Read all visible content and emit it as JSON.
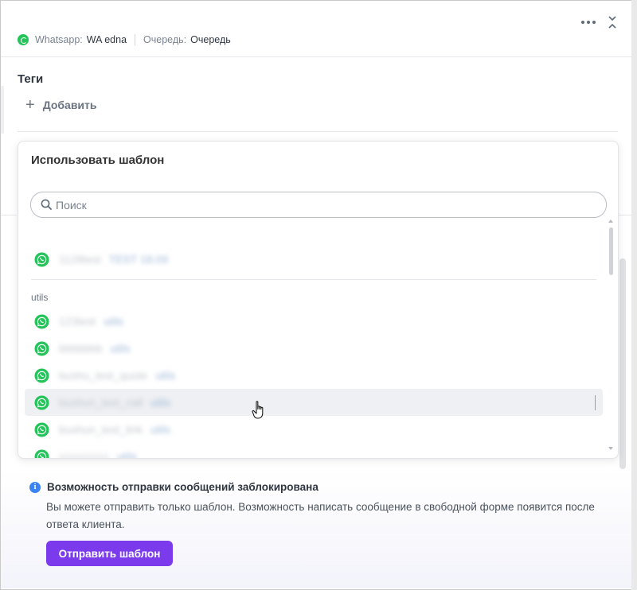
{
  "header": {
    "channel_label": "Whatsapp:",
    "channel_value": "WA edna",
    "queue_label": "Очередь:",
    "queue_value": "Очередь",
    "icons": [
      "more-icon",
      "collapse-icon",
      "whatsapp-icon"
    ]
  },
  "tags": {
    "title": "Теги",
    "add_label": "Добавить"
  },
  "template_popup": {
    "title": "Использовать шаблон",
    "search_placeholder": "Поиск",
    "group_label": "utils",
    "items": [
      {
        "name": "1128test",
        "sub": "TEST 18.09"
      },
      {
        "name": "123test",
        "sub": "utils"
      },
      {
        "name": "bbbbbbb",
        "sub": "utils"
      },
      {
        "name": "bushu_test_quote",
        "sub": "utils"
      },
      {
        "name": "bushun_test_call",
        "sub": "utils"
      },
      {
        "name": "bushun_test_link",
        "sub": "utils"
      },
      {
        "name": "ccccccccc",
        "sub": "utils"
      }
    ]
  },
  "blocked": {
    "title": "Возможность отправки сообщений заблокирована",
    "text": "Вы можете отправить только шаблон. Возможность написать сообщение в свободной форме появится после ответа клиента.",
    "button": "Отправить шаблон"
  },
  "colors": {
    "accent": "#7c3aed",
    "whatsapp": "#25c45a",
    "info": "#3b82f6"
  }
}
